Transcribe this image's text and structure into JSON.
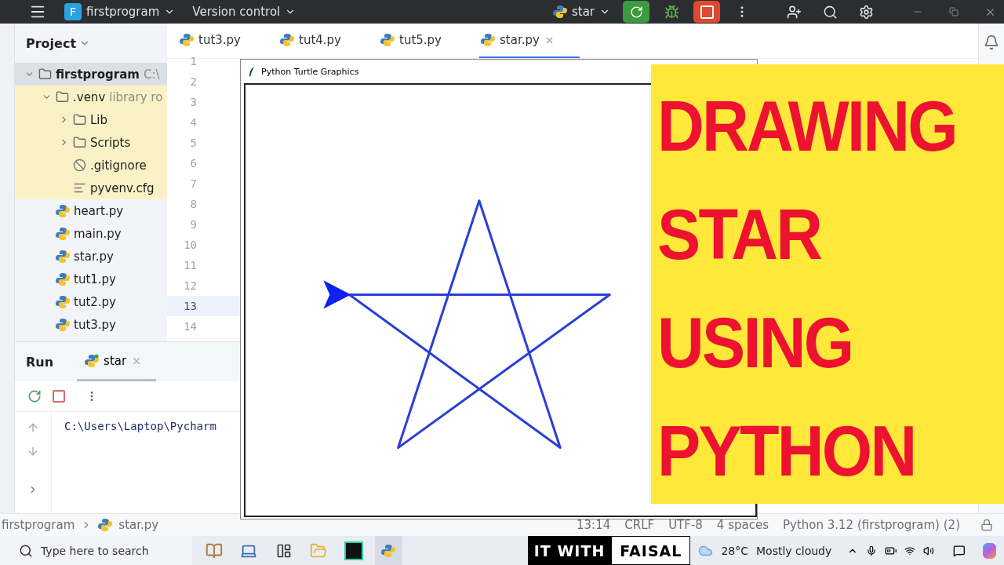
{
  "title_bar": {
    "project_initial": "F",
    "project": "firstprogram",
    "vcs": "Version control",
    "run_config": "star"
  },
  "project_panel": {
    "title": "Project",
    "tree": [
      {
        "name": "firstprogram",
        "hint": "C:\\",
        "kind": "folder",
        "expanded": true,
        "selected": true,
        "children": [
          {
            "name": ".venv",
            "hint": "library ro",
            "kind": "folder",
            "expanded": true,
            "selected": false,
            "excluded": true,
            "children": [
              {
                "name": "Lib",
                "kind": "folder",
                "expanded": false,
                "selected": false
              },
              {
                "name": "Scripts",
                "kind": "folder",
                "expanded": false,
                "selected": false
              },
              {
                "name": ".gitignore",
                "kind": "ignore",
                "selected": false
              },
              {
                "name": "pyvenv.cfg",
                "kind": "text",
                "selected": false
              }
            ]
          },
          {
            "name": "heart.py",
            "kind": "python",
            "selected": false
          },
          {
            "name": "main.py",
            "kind": "python",
            "selected": false
          },
          {
            "name": "star.py",
            "kind": "python",
            "selected": false
          },
          {
            "name": "tut1.py",
            "kind": "python",
            "selected": false
          },
          {
            "name": "tut2.py",
            "kind": "python",
            "selected": false
          },
          {
            "name": "tut3.py",
            "kind": "python",
            "selected": false
          }
        ]
      }
    ]
  },
  "editor": {
    "tabs": [
      {
        "label": "tut3.py",
        "selected": false
      },
      {
        "label": "tut4.py",
        "selected": false
      },
      {
        "label": "tut5.py",
        "selected": false
      },
      {
        "label": "star.py",
        "selected": true
      }
    ],
    "lines": [
      {
        "number": "1",
        "current": false
      },
      {
        "number": "2",
        "current": false
      },
      {
        "number": "3",
        "current": false
      },
      {
        "number": "4",
        "current": false
      },
      {
        "number": "5",
        "current": false
      },
      {
        "number": "6",
        "current": false
      },
      {
        "number": "7",
        "current": false
      },
      {
        "number": "8",
        "current": false
      },
      {
        "number": "9",
        "current": false
      },
      {
        "number": "10",
        "current": false
      },
      {
        "number": "11",
        "current": false
      },
      {
        "number": "12",
        "current": false
      },
      {
        "number": "13",
        "current": true
      },
      {
        "number": "14",
        "current": false
      }
    ]
  },
  "run_panel": {
    "title": "Run",
    "tabs": [
      {
        "label": "star",
        "selected": true
      }
    ],
    "console": "C:\\Users\\Laptop\\Pycharm"
  },
  "turtle_window": {
    "title": "Python Turtle Graphics"
  },
  "banner": {
    "lines": [
      "DRAWING",
      "STAR",
      "USING",
      "PYTHON"
    ]
  },
  "status_bar": {
    "breadcrumbs": [
      "firstprogram",
      "star.py"
    ],
    "items": [
      "13:14",
      "CRLF",
      "UTF-8",
      "4 spaces",
      "Python 3.12 (firstprogram) (2)"
    ]
  },
  "taskbar": {
    "search_placeholder": "Type here to search",
    "channel": [
      "IT WITH",
      "FAISAL"
    ],
    "temperature": "28°C",
    "weather": "Mostly cloudy"
  }
}
